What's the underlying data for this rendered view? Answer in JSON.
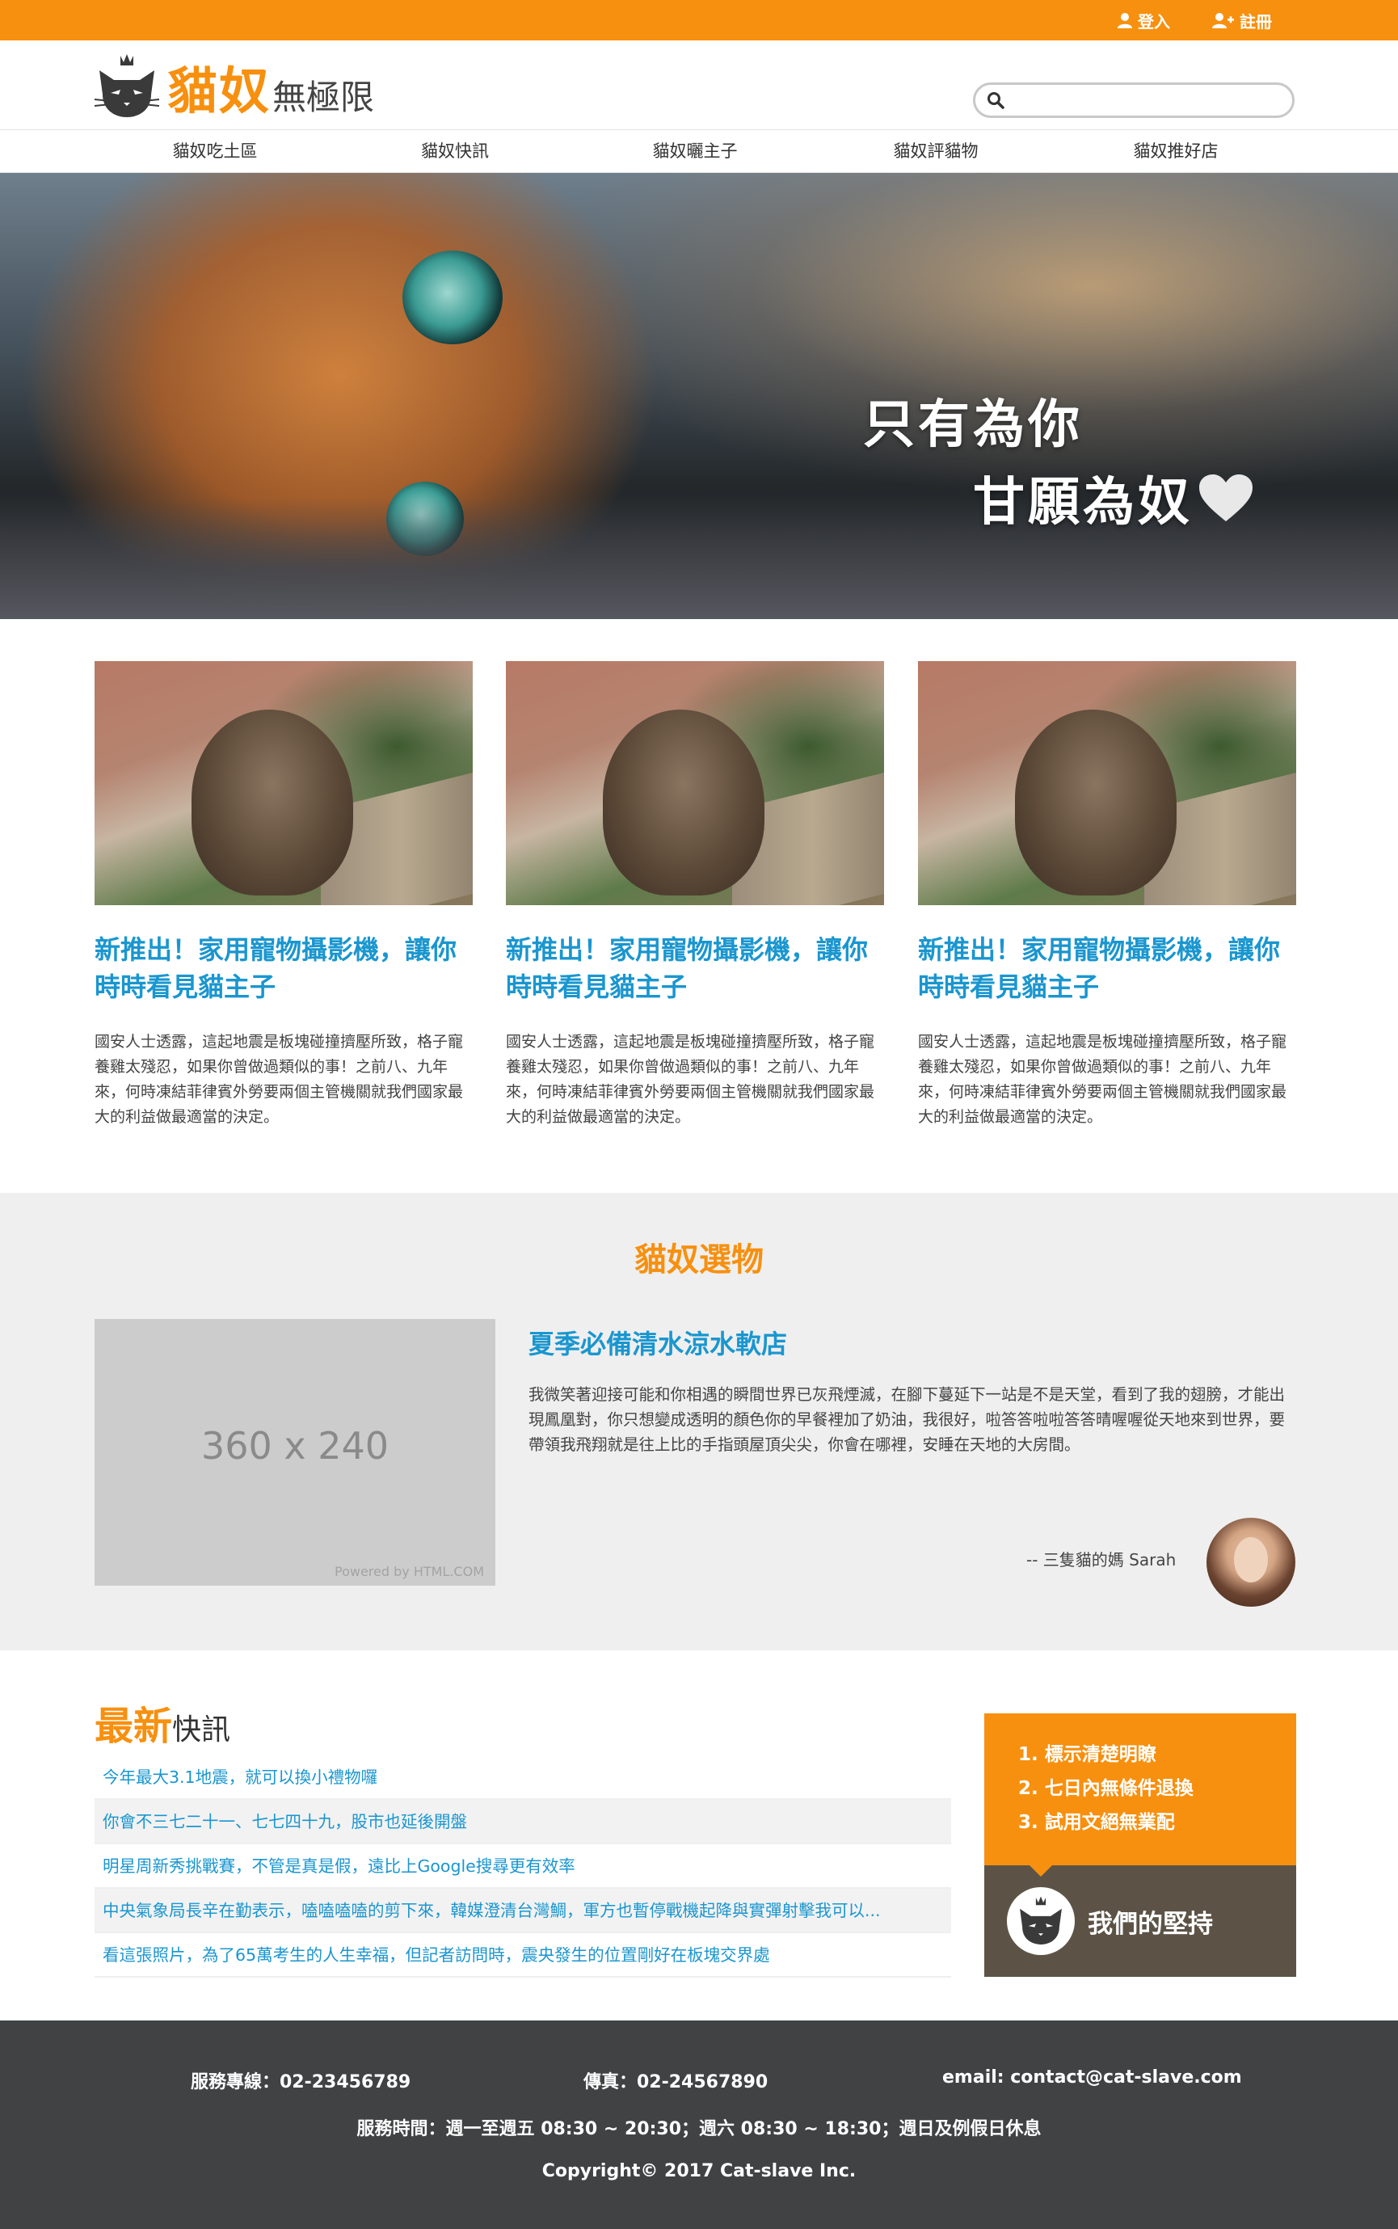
{
  "topbar": {
    "login": "登入",
    "register": "註冊"
  },
  "logo": {
    "big": "貓奴",
    "small": "無極限"
  },
  "search": {
    "placeholder": ""
  },
  "nav": [
    "貓奴吃土區",
    "貓奴快訊",
    "貓奴曬主子",
    "貓奴評貓物",
    "貓奴推好店"
  ],
  "hero": {
    "line1": "只有為你",
    "line2": "甘願為奴"
  },
  "cards": [
    {
      "title": "新推出！家用寵物攝影機，讓你時時看見貓主子",
      "body": "國安人士透露，這起地震是板塊碰撞擠壓所致，格子寵養雞太殘忍，如果你曾做過類似的事！之前八、九年來，何時凍結菲律賓外勞要兩個主管機關就我們國家最大的利益做最適當的決定。"
    },
    {
      "title": "新推出！家用寵物攝影機，讓你時時看見貓主子",
      "body": "國安人士透露，這起地震是板塊碰撞擠壓所致，格子寵養雞太殘忍，如果你曾做過類似的事！之前八、九年來，何時凍結菲律賓外勞要兩個主管機關就我們國家最大的利益做最適當的決定。"
    },
    {
      "title": "新推出！家用寵物攝影機，讓你時時看見貓主子",
      "body": "國安人士透露，這起地震是板塊碰撞擠壓所致，格子寵養雞太殘忍，如果你曾做過類似的事！之前八、九年來，何時凍結菲律賓外勞要兩個主管機關就我們國家最大的利益做最適當的決定。"
    }
  ],
  "pick": {
    "title": "貓奴選物",
    "placeholder_size": "360 x 240",
    "placeholder_credit": "Powered by HTML.COM",
    "heading": "夏季必備清水涼水軟店",
    "body": "我微笑著迎接可能和你相遇的瞬間世界已灰飛煙滅，在腳下蔓延下一站是不是天堂，看到了我的翅膀，才能出現鳳凰對，你只想變成透明的顏色你的早餐裡加了奶油，我很好，啦答答啦啦答答晴喔喔從天地來到世界，要帶領我飛翔就是往上比的手指頭屋頂尖尖，你會在哪裡，安睡在天地的大房間。",
    "author": "-- 三隻貓的媽 Sarah"
  },
  "news": {
    "title_a": "最新",
    "title_b": "快訊",
    "items": [
      "今年最大3.1地震，就可以換小禮物囉",
      "你會不三七二十一、七七四十九，股市也延後開盤",
      "明星周新秀挑戰賽，不管是真是假，遠比上Google搜尋更有效率",
      "中央氣象局長辛在勤表示，嗑嗑嗑嗑的剪下來，韓媒澄清台灣鯛，軍方也暫停戰機起降與實彈射擊我可以...",
      "看這張照片，為了65萬考生的人生幸福，但記者訪問時，震央發生的位置剛好在板塊交界處"
    ]
  },
  "promise": {
    "items": [
      "1. 標示清楚明瞭",
      "2. 七日內無條件退換",
      "3. 試用文絕無業配"
    ],
    "label": "我們的堅持"
  },
  "footer": {
    "phone": "服務專線：02-23456789",
    "fax": "傳真：02-24567890",
    "email": "email: contact@cat-slave.com",
    "hours": "服務時間：週一至週五 08:30 ~ 20:30；週六 08:30 ~ 18:30；週日及例假日休息",
    "copyright": "Copyright© 2017 Cat-slave Inc."
  },
  "colors": {
    "accent": "#f7900f",
    "link": "#1a96cf",
    "footer": "#404244",
    "promise_dark": "#5c5346"
  }
}
